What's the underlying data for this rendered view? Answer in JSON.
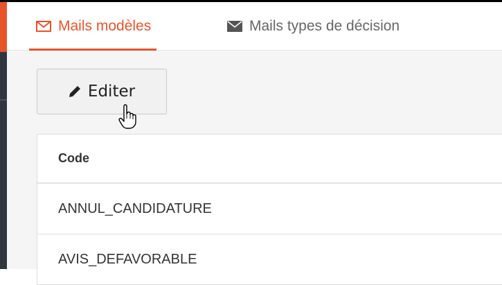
{
  "tabs": [
    {
      "label": "Mails modèles",
      "icon": "envelope-outline-icon",
      "active": true
    },
    {
      "label": "Mails types de décision",
      "icon": "envelope-icon",
      "active": false
    }
  ],
  "toolbar": {
    "edit_label": "Editer",
    "edit_icon": "pencil-icon"
  },
  "table": {
    "columns": [
      "Code"
    ],
    "rows": [
      "ANNUL_CANDIDATURE",
      "AVIS_DEFAVORABLE"
    ]
  },
  "colors": {
    "accent": "#e8542a",
    "sidebar": "#2f3640",
    "text": "#333333"
  }
}
